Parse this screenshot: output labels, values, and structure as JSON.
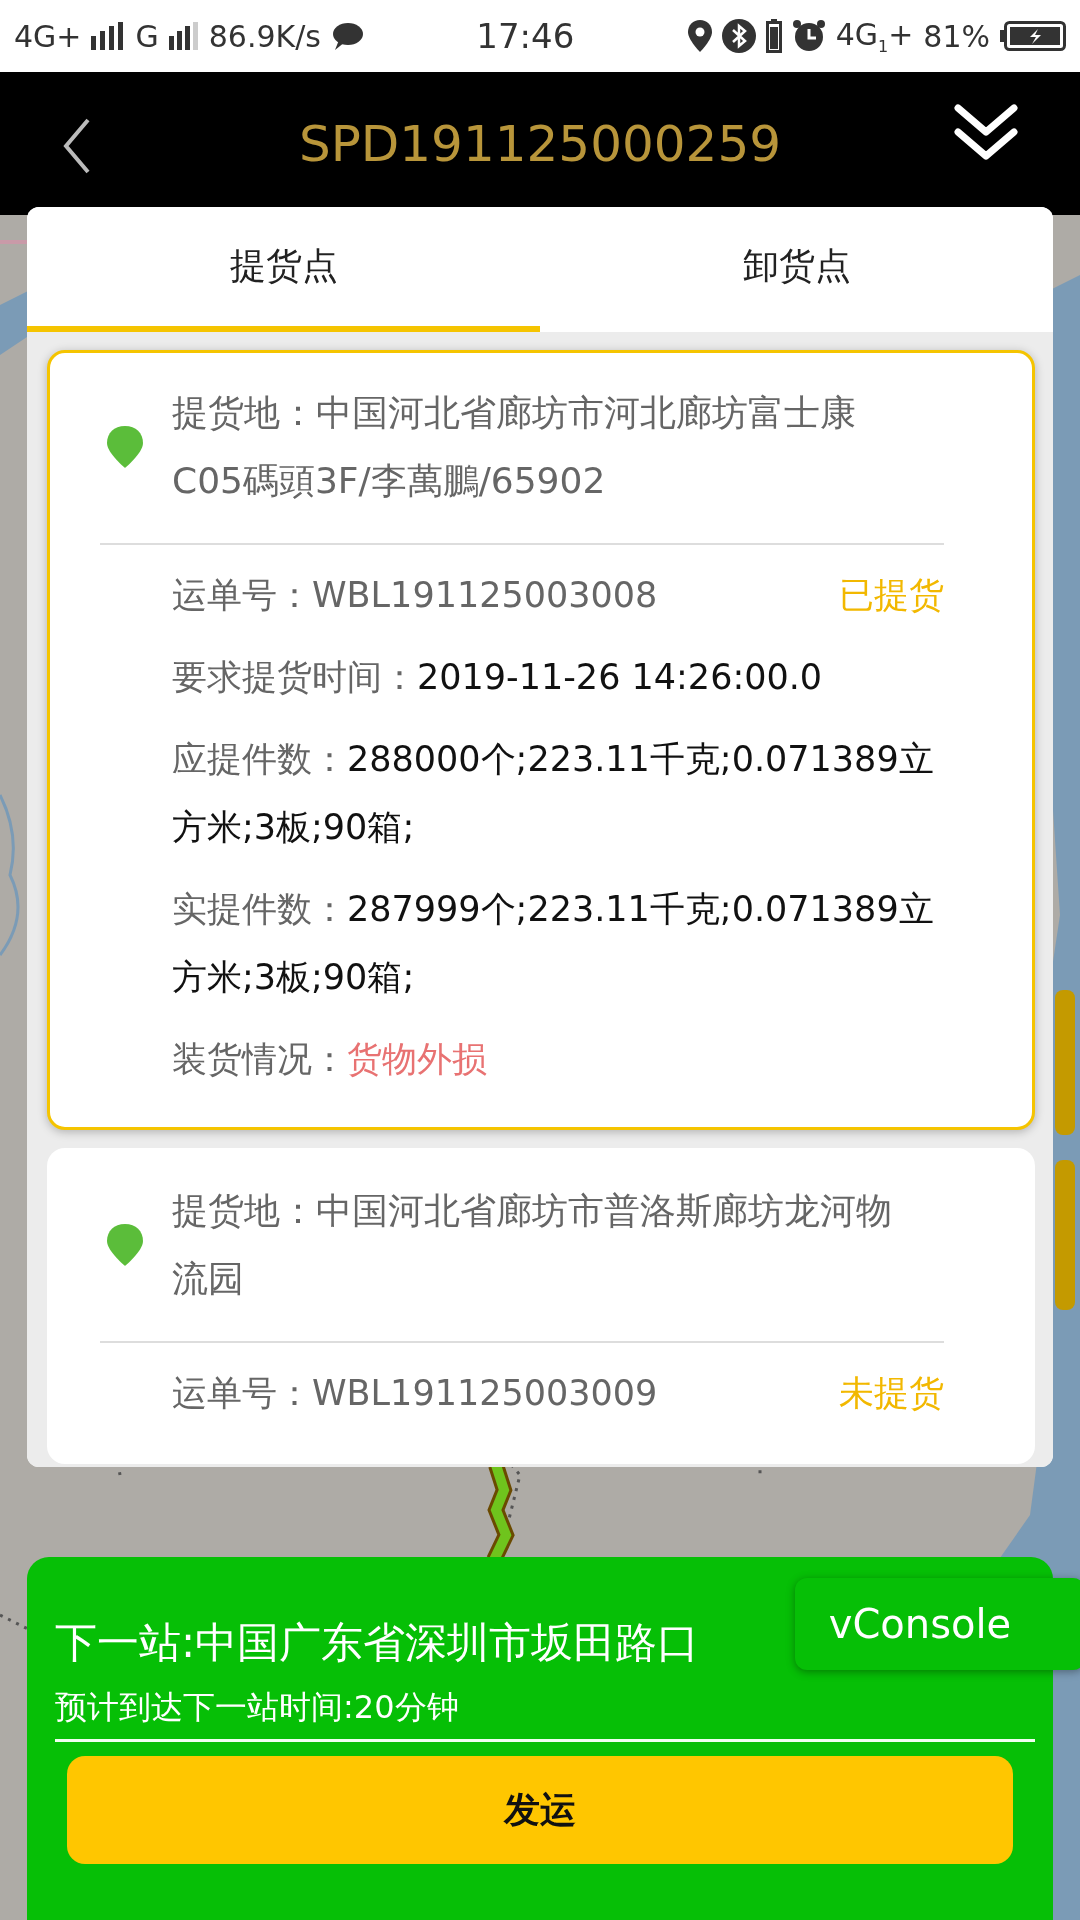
{
  "status_bar": {
    "network_1": "4G+",
    "network_2": "G",
    "speed": "86.9K/s",
    "time": "17:46",
    "network_3": "4G$_{1}$+",
    "battery": "81%"
  },
  "header": {
    "title": "SPD191125000259"
  },
  "tabs": [
    {
      "label": "提货点",
      "selected": true
    },
    {
      "label": "卸货点",
      "selected": false
    }
  ],
  "pickups": [
    {
      "selected": true,
      "address": "提货地：中国河北省廊坊市河北廊坊富士康C05碼頭3F/李萬鵬/65902",
      "waybill_label": "运单号：",
      "waybill": "WBL191125003008",
      "status": "已提货",
      "details": [
        {
          "label": "要求提货时间：",
          "value": "2019-11-26 14:26:00.0",
          "kind": "normal"
        },
        {
          "label": "应提件数：",
          "value": "288000个;223.11千克;0.071389立方米;3板;90箱;",
          "kind": "normal"
        },
        {
          "label": "实提件数：",
          "value": "287999个;223.11千克;0.071389立方米;3板;90箱;",
          "kind": "normal"
        },
        {
          "label": "装货情况：",
          "value": "货物外损",
          "kind": "alert"
        }
      ]
    },
    {
      "selected": false,
      "address": "提货地：中国河北省廊坊市普洛斯廊坊龙河物流园",
      "waybill_label": "运单号：",
      "waybill": "WBL191125003009",
      "status": "未提货"
    }
  ],
  "next_stop": {
    "title": "下一站:中国广东省深圳市坂田路口",
    "eta": "预计到达下一站时间:20分钟",
    "button": "发运"
  },
  "console_button": "vConsole"
}
